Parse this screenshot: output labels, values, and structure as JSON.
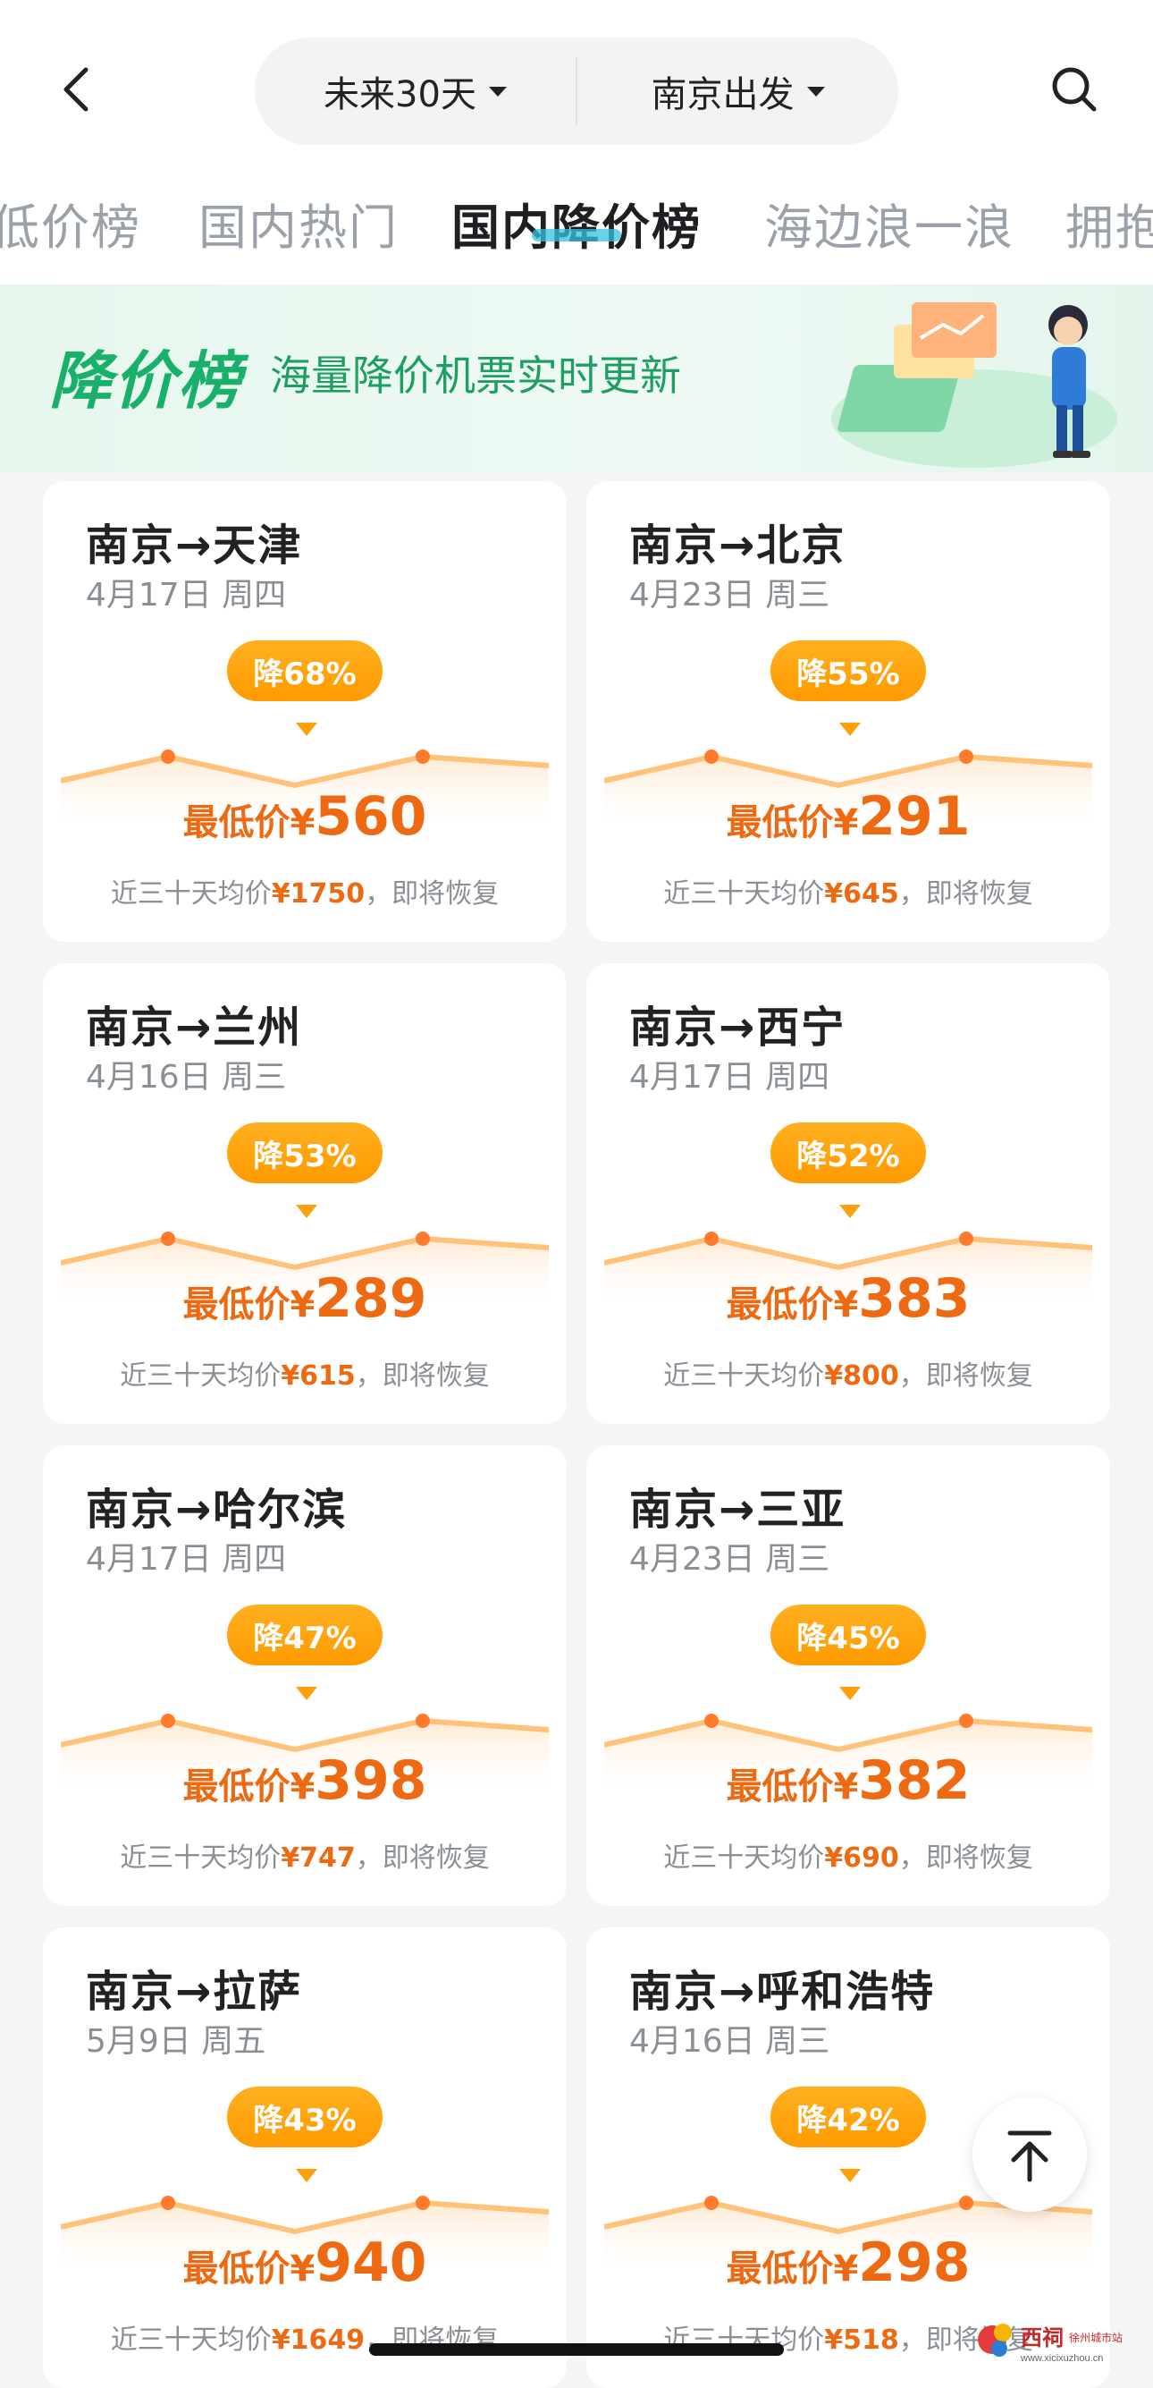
{
  "header": {
    "date_filter": "未来30天",
    "origin_filter": "南京出发"
  },
  "tabs": [
    {
      "label": "低价榜"
    },
    {
      "label": "国内热门"
    },
    {
      "label": "国内降价榜"
    },
    {
      "label": "海边浪一浪"
    },
    {
      "label": "拥抱"
    }
  ],
  "banner": {
    "title": "降价榜",
    "subtitle": "海量降价机票实时更新"
  },
  "price_label": "最低价¥",
  "avg_prefix": "近三十天均价",
  "avg_suffix": "，即将恢复",
  "cards": [
    {
      "route": "南京→天津",
      "date": "4月17日 周四",
      "discount": "降68%",
      "price": "560",
      "avg": "¥1750"
    },
    {
      "route": "南京→北京",
      "date": "4月23日 周三",
      "discount": "降55%",
      "price": "291",
      "avg": "¥645"
    },
    {
      "route": "南京→兰州",
      "date": "4月16日 周三",
      "discount": "降53%",
      "price": "289",
      "avg": "¥615"
    },
    {
      "route": "南京→西宁",
      "date": "4月17日 周四",
      "discount": "降52%",
      "price": "383",
      "avg": "¥800"
    },
    {
      "route": "南京→哈尔滨",
      "date": "4月17日 周四",
      "discount": "降47%",
      "price": "398",
      "avg": "¥747"
    },
    {
      "route": "南京→三亚",
      "date": "4月23日 周三",
      "discount": "降45%",
      "price": "382",
      "avg": "¥690"
    },
    {
      "route": "南京→拉萨",
      "date": "5月9日 周五",
      "discount": "降43%",
      "price": "940",
      "avg": "¥1649"
    },
    {
      "route": "南京→呼和浩特",
      "date": "4月16日 周三",
      "discount": "降42%",
      "price": "298",
      "avg": "¥518"
    }
  ],
  "watermark": {
    "brand": "西祠",
    "sub": "徐州城市站",
    "url": "www.xicixuzhou.cn"
  },
  "colors": {
    "accent": "#ee6a12",
    "badge": "#ff9f0a",
    "green": "#19b06a",
    "tab_underline": "#34c3e0"
  },
  "icons": [
    "back-arrow-icon",
    "search-icon",
    "chevron-down-icon",
    "scroll-to-top-icon"
  ]
}
